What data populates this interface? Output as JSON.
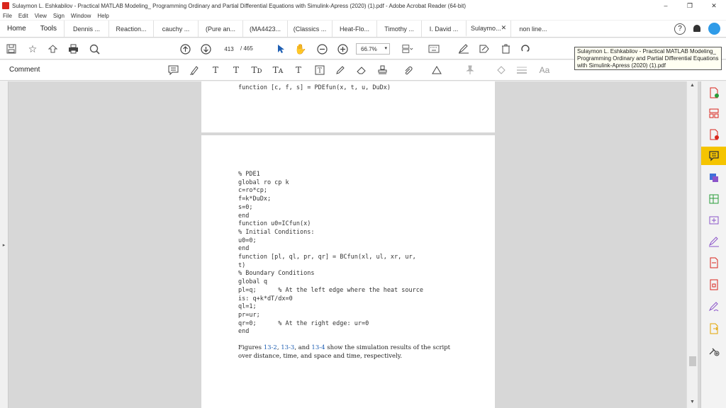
{
  "window": {
    "title": "Sulaymon L. Eshkabilov - Practical MATLAB Modeling_ Programming Ordinary and Partial Differential Equations with Simulink-Apress (2020) (1).pdf - Adobe Acrobat Reader (64-bit)",
    "controls": [
      "–",
      "❐",
      "✕"
    ]
  },
  "menu": [
    "File",
    "Edit",
    "View",
    "Sign",
    "Window",
    "Help"
  ],
  "tabs": {
    "home": "Home",
    "tools": "Tools",
    "docs": [
      "Dennis ...",
      "Reaction...",
      "cauchy ...",
      "(Pure an...",
      "(MA4423...",
      "(Classics ...",
      "Heat-Flo...",
      "Timothy ...",
      "I. David ...",
      "Sulaymo...",
      "non line..."
    ],
    "active_index": 9,
    "close_glyph": "✕",
    "help_glyph": "?"
  },
  "toolbar": {
    "page_current": "413",
    "page_total": "/ 465",
    "zoom": "66.7%",
    "zoom_arrow": "▾"
  },
  "tooltip": {
    "text": "Sulaymon L. Eshkabilov - Practical MATLAB Modeling_ Programming Ordinary and Partial Differential Equations with Simulink-Apress (2020) (1).pdf"
  },
  "comment_bar": {
    "label": "Comment",
    "text_tools": [
      "T",
      "T",
      "Tᴅ",
      "Tᴀ",
      "T",
      "T"
    ],
    "font_label": "Aa"
  },
  "viewer": {
    "left_arrow": "▸",
    "right_arrow": "◂",
    "scroll_up": "▲",
    "scroll_down": "▼"
  },
  "document": {
    "page1_code": "function [c, f, s] = PDEfun(x, t, u, DuDx)",
    "page2_code": "% PDE1\nglobal ro cp k\nc=ro*cp;\nf=k*DuDx;\ns=0;\nend\nfunction u0=ICfun(x)\n% Initial Conditions:\nu0=0;\nend\nfunction [pl, ql, pr, qr] = BCfun(xl, ul, xr, ur,\nt)\n% Boundary Conditions\nglobal q\npl=q;      % At the left edge where the heat source\nis: q+k*dT/dx=0\nql=1;\npr=ur;\nqr=0;      % At the right edge: ur=0\nend",
    "para_pre": "Figures ",
    "fig1": "13-2",
    "sep1": ", ",
    "fig2": "13-3",
    "sep2": ", and ",
    "fig3": "13-4",
    "para_post": " show the simulation results of the script over distance, time, and space and time, respectively."
  },
  "colors": {
    "accent_yellow": "#f5c400",
    "link_blue": "#1f5fb3",
    "acrobat_red": "#d9261c"
  }
}
